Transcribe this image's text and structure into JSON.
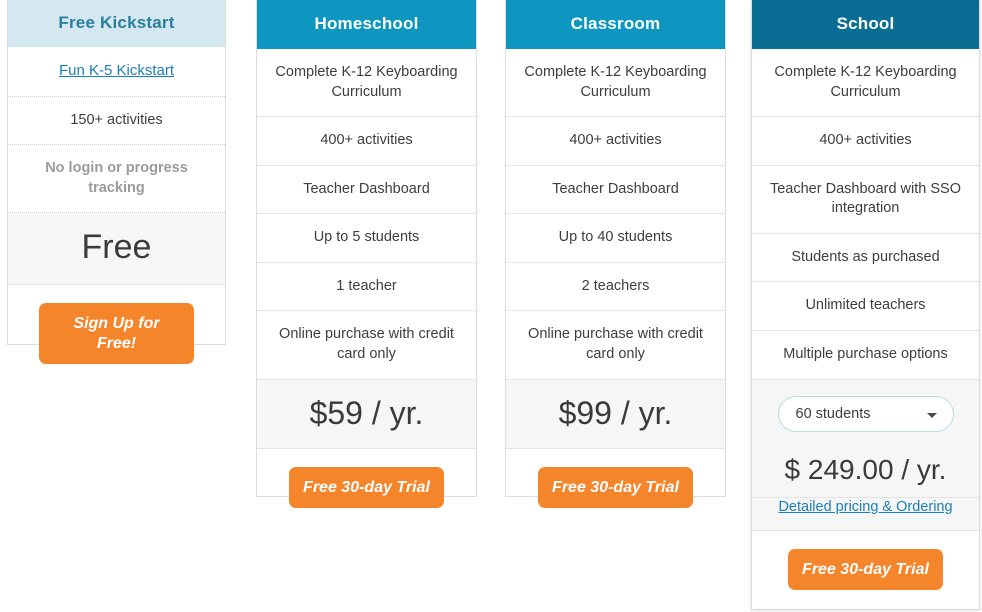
{
  "theme": {
    "header_light_bg": "#d3e8f0",
    "header_light_text": "#2a7e9e",
    "header_primary_bg": "#0d97c0",
    "header_dark_bg": "#0a6e94",
    "cta_orange": "#f5852a",
    "link_blue": "#1b7fb8",
    "price_row_bg": "#f6f6f6"
  },
  "plans": [
    {
      "id": "kickstart",
      "title": "Free Kickstart",
      "features": [
        {
          "text": "Fun K-5 Kickstart",
          "style": "link"
        },
        {
          "text": "150+ activities",
          "style": "normal"
        },
        {
          "text": "No login or progress tracking",
          "style": "muted-strong"
        }
      ],
      "price": "Free",
      "cta_label": "Sign Up for Free!"
    },
    {
      "id": "homeschool",
      "title": "Homeschool",
      "features": [
        {
          "text": "Complete K-12 Keyboarding Curriculum",
          "style": "normal"
        },
        {
          "text": "400+ activities",
          "style": "normal"
        },
        {
          "text": "Teacher Dashboard",
          "style": "normal"
        },
        {
          "text": "Up to 5 students",
          "style": "normal"
        },
        {
          "text": "1 teacher",
          "style": "normal"
        },
        {
          "text": "Online purchase with credit card only",
          "style": "normal"
        }
      ],
      "price": "$59 / yr.",
      "cta_label": "Free 30-day Trial"
    },
    {
      "id": "classroom",
      "title": "Classroom",
      "features": [
        {
          "text": "Complete K-12 Keyboarding Curriculum",
          "style": "normal"
        },
        {
          "text": "400+ activities",
          "style": "normal"
        },
        {
          "text": "Teacher Dashboard",
          "style": "normal"
        },
        {
          "text": "Up to 40 students",
          "style": "normal"
        },
        {
          "text": "2 teachers",
          "style": "normal"
        },
        {
          "text": "Online purchase with credit card only",
          "style": "normal"
        }
      ],
      "price": "$99 / yr.",
      "cta_label": "Free 30-day Trial"
    },
    {
      "id": "school",
      "title": "School",
      "features": [
        {
          "text": "Complete K-12 Keyboarding Curriculum",
          "style": "normal"
        },
        {
          "text": "400+ activities",
          "style": "normal"
        },
        {
          "text": "Teacher Dashboard with SSO integration",
          "style": "normal"
        },
        {
          "text": "Students as purchased",
          "style": "normal"
        },
        {
          "text": "Unlimited teachers",
          "style": "normal"
        },
        {
          "text": "Multiple purchase options",
          "style": "normal"
        }
      ],
      "student_select": {
        "value": "60 students",
        "caret_icon": "chevron-down-icon"
      },
      "price": "$ 249.00 / yr.",
      "detail_link": "Detailed pricing & Ordering",
      "cta_label": "Free 30-day Trial"
    }
  ]
}
